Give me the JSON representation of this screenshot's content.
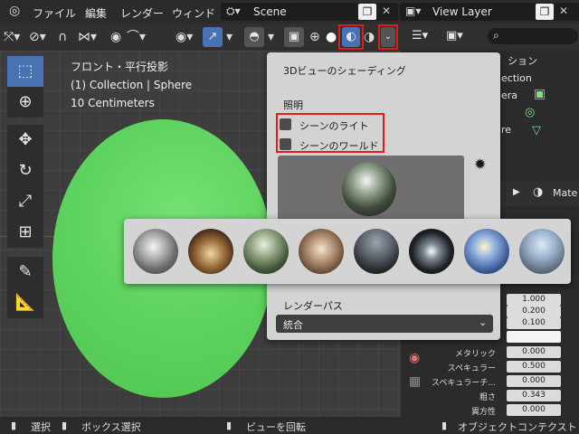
{
  "menubar": {
    "items": [
      "ファイル",
      "編集",
      "レンダー",
      "ウィンド"
    ],
    "scene_field": "Scene",
    "view_layer_field": "View Layer"
  },
  "viewport": {
    "info_lines": [
      "フロント・平行投影",
      "(1) Collection | Sphere",
      "10 Centimeters"
    ]
  },
  "popover": {
    "title": "3Dビューのシェーディング",
    "lighting_label": "照明",
    "scene_lights_label": "シーンのライト",
    "scene_world_label": "シーンのワールド",
    "render_pass_label": "レンダーパス",
    "render_pass_value": "統合"
  },
  "outliner": {
    "partial_items": [
      "ション",
      "ection",
      "era",
      "re"
    ]
  },
  "properties": {
    "header_partial": "Mate",
    "values_top": [
      "1.000",
      "0.200",
      "0.100"
    ],
    "rows": [
      {
        "label": "メタリック",
        "value": "0.000"
      },
      {
        "label": "スペキュラー",
        "value": "0.500"
      },
      {
        "label": "スペキュラーチ...",
        "value": "0.000"
      },
      {
        "label": "粗さ",
        "value": "0.343"
      },
      {
        "label": "異方性",
        "value": "0.000"
      }
    ]
  },
  "statusbar": {
    "select": "選択",
    "box_select": "ボックス選択",
    "rotate_view": "ビューを回転",
    "object_context": "オブジェクトコンテクスト"
  },
  "colors": {
    "highlight_red": "#e21c1c",
    "active_blue": "#4772b3",
    "sphere_green": "#5fd35f"
  }
}
